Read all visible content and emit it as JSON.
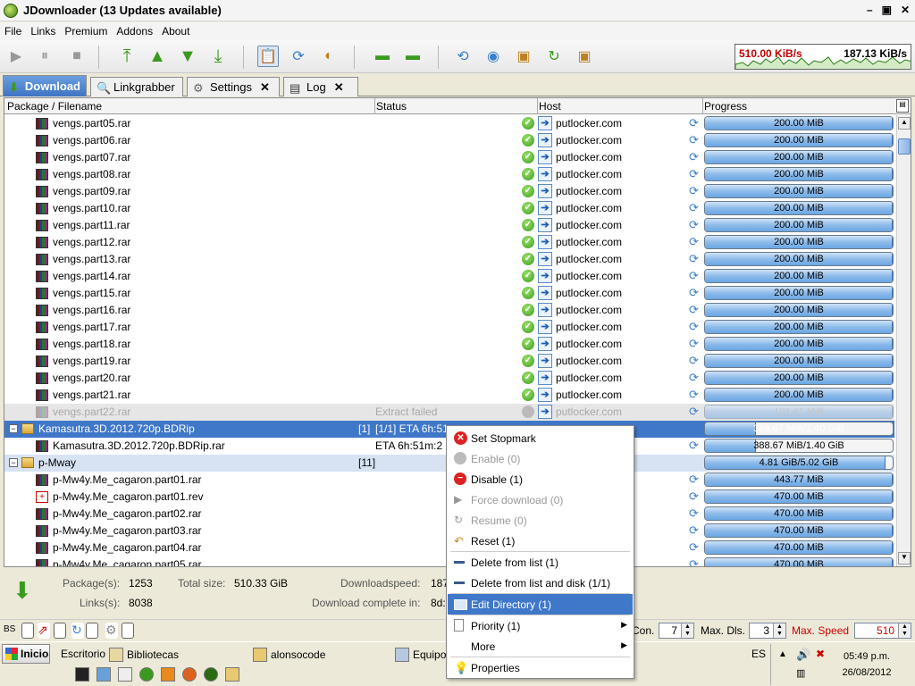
{
  "window": {
    "title": "JDownloader (13 Updates available)"
  },
  "menu": [
    "File",
    "Links",
    "Premium",
    "Addons",
    "About"
  ],
  "speed": {
    "down": "510.00 KiB/s",
    "limit": "187.13 KiB/s"
  },
  "tabs": [
    {
      "label": "Download",
      "closable": false
    },
    {
      "label": "Linkgrabber",
      "closable": false
    },
    {
      "label": "Settings",
      "closable": true
    },
    {
      "label": "Log",
      "closable": true
    }
  ],
  "columns": {
    "filename": "Package / Filename",
    "status": "Status",
    "host": "Host",
    "progress": "Progress"
  },
  "rows": [
    {
      "name": "vengs.part05.rar",
      "host": "putlocker.com",
      "progress": "200.00 MiB",
      "pct": 1.0
    },
    {
      "name": "vengs.part06.rar",
      "host": "putlocker.com",
      "progress": "200.00 MiB",
      "pct": 1.0
    },
    {
      "name": "vengs.part07.rar",
      "host": "putlocker.com",
      "progress": "200.00 MiB",
      "pct": 1.0
    },
    {
      "name": "vengs.part08.rar",
      "host": "putlocker.com",
      "progress": "200.00 MiB",
      "pct": 1.0
    },
    {
      "name": "vengs.part09.rar",
      "host": "putlocker.com",
      "progress": "200.00 MiB",
      "pct": 1.0
    },
    {
      "name": "vengs.part10.rar",
      "host": "putlocker.com",
      "progress": "200.00 MiB",
      "pct": 1.0
    },
    {
      "name": "vengs.part11.rar",
      "host": "putlocker.com",
      "progress": "200.00 MiB",
      "pct": 1.0
    },
    {
      "name": "vengs.part12.rar",
      "host": "putlocker.com",
      "progress": "200.00 MiB",
      "pct": 1.0
    },
    {
      "name": "vengs.part13.rar",
      "host": "putlocker.com",
      "progress": "200.00 MiB",
      "pct": 1.0
    },
    {
      "name": "vengs.part14.rar",
      "host": "putlocker.com",
      "progress": "200.00 MiB",
      "pct": 1.0
    },
    {
      "name": "vengs.part15.rar",
      "host": "putlocker.com",
      "progress": "200.00 MiB",
      "pct": 1.0
    },
    {
      "name": "vengs.part16.rar",
      "host": "putlocker.com",
      "progress": "200.00 MiB",
      "pct": 1.0
    },
    {
      "name": "vengs.part17.rar",
      "host": "putlocker.com",
      "progress": "200.00 MiB",
      "pct": 1.0
    },
    {
      "name": "vengs.part18.rar",
      "host": "putlocker.com",
      "progress": "200.00 MiB",
      "pct": 1.0
    },
    {
      "name": "vengs.part19.rar",
      "host": "putlocker.com",
      "progress": "200.00 MiB",
      "pct": 1.0
    },
    {
      "name": "vengs.part20.rar",
      "host": "putlocker.com",
      "progress": "200.00 MiB",
      "pct": 1.0
    },
    {
      "name": "vengs.part21.rar",
      "host": "putlocker.com",
      "progress": "200.00 MiB",
      "pct": 1.0
    }
  ],
  "failed_row": {
    "name": "vengs.part22.rar",
    "status": "Extract failed",
    "host": "putlocker.com",
    "progress": "101.41 MiB",
    "pct": 1.0
  },
  "package1": {
    "name": "Kamasutra.3D.2012.720p.BDRip",
    "count": "[1]",
    "status": "[1/1] ETA 6h:51",
    "progress": "388.67 MiB/1.40 GiB",
    "pct": 0.27
  },
  "package1_file": {
    "name": "Kamasutra.3D.2012.720p.BDRip.rar",
    "status": "ETA 6h:51m:2",
    "host": "uploaded.net",
    "progress": "388.67 MiB/1.40 GiB",
    "pct": 0.27
  },
  "package2": {
    "name": "p-Mway",
    "count": "[11]",
    "host": "[putlocker.com]",
    "progress": "4.81 GiB/5.02 GiB",
    "pct": 0.96
  },
  "package2_files": [
    {
      "name": "p-Mw4y.Me_cagaron.part01.rar",
      "host": "putlocker.com",
      "progress": "443.77 MiB",
      "pct": 1.0,
      "type": "rar"
    },
    {
      "name": "p-Mw4y.Me_cagaron.part01.rev",
      "host": "putlocker.com",
      "progress": "470.00 MiB",
      "pct": 1.0,
      "type": "rev"
    },
    {
      "name": "p-Mw4y.Me_cagaron.part02.rar",
      "host": "putlocker.com",
      "progress": "470.00 MiB",
      "pct": 1.0,
      "type": "rar"
    },
    {
      "name": "p-Mw4y.Me_cagaron.part03.rar",
      "host": "putlocker.com",
      "progress": "470.00 MiB",
      "pct": 1.0,
      "type": "rar"
    },
    {
      "name": "p-Mw4y.Me_cagaron.part04.rar",
      "host": "putlocker.com",
      "progress": "470.00 MiB",
      "pct": 1.0,
      "type": "rar"
    },
    {
      "name": "p-Mw4y.Me_cagaron.part05.rar",
      "host": "putlocker.com",
      "progress": "470.00 MiB",
      "pct": 1.0,
      "type": "rar"
    }
  ],
  "info": {
    "packages_label": "Package(s):",
    "packages": "1253",
    "total_label": "Total size:",
    "total": "510.33 GiB",
    "speed_label": "Downloadspeed:",
    "speed": "187",
    "links_label": "Links(s):",
    "links": "8038",
    "complete_label": "Download complete in:",
    "complete": "8d:"
  },
  "bottombar": {
    "bs": "BS",
    "con_label": "Con.",
    "con": "7",
    "maxdls_label": "Max. Dls.",
    "maxdls": "3",
    "maxspeed_label": "Max. Speed",
    "maxspeed": "510"
  },
  "context_menu": [
    {
      "label": "Set Stopmark",
      "disabled": false,
      "icon": "stop-icon"
    },
    {
      "label": "Enable (0)",
      "disabled": true,
      "icon": "enable-icon"
    },
    {
      "label": "Disable (1)",
      "disabled": false,
      "icon": "disable-icon"
    },
    {
      "label": "Force download (0)",
      "disabled": true,
      "icon": "play-icon"
    },
    {
      "label": "Resume (0)",
      "disabled": true,
      "icon": "resume-icon"
    },
    {
      "label": "Reset (1)",
      "disabled": false,
      "icon": "reset-icon"
    },
    {
      "label": "Delete from list (1)",
      "disabled": false,
      "icon": "dash-icon"
    },
    {
      "label": "Delete from list and disk (1/1)",
      "disabled": false,
      "icon": "dash-icon"
    },
    {
      "label": "Edit Directory (1)",
      "disabled": false,
      "icon": "folder-icon",
      "highlighted": true
    },
    {
      "label": "Priority (1)",
      "disabled": false,
      "icon": "page-icon",
      "submenu": true
    },
    {
      "label": "More",
      "disabled": false,
      "icon": "blank-icon",
      "submenu": true
    },
    {
      "label": "Properties",
      "disabled": false,
      "icon": "bulb-icon"
    }
  ],
  "taskbar": {
    "start": "Inicio",
    "items": [
      "Escritorio",
      "Bibliotecas",
      "alonsocode",
      "Equipo"
    ],
    "lang": "ES",
    "time": "05:49 p.m.",
    "date": "26/08/2012"
  }
}
